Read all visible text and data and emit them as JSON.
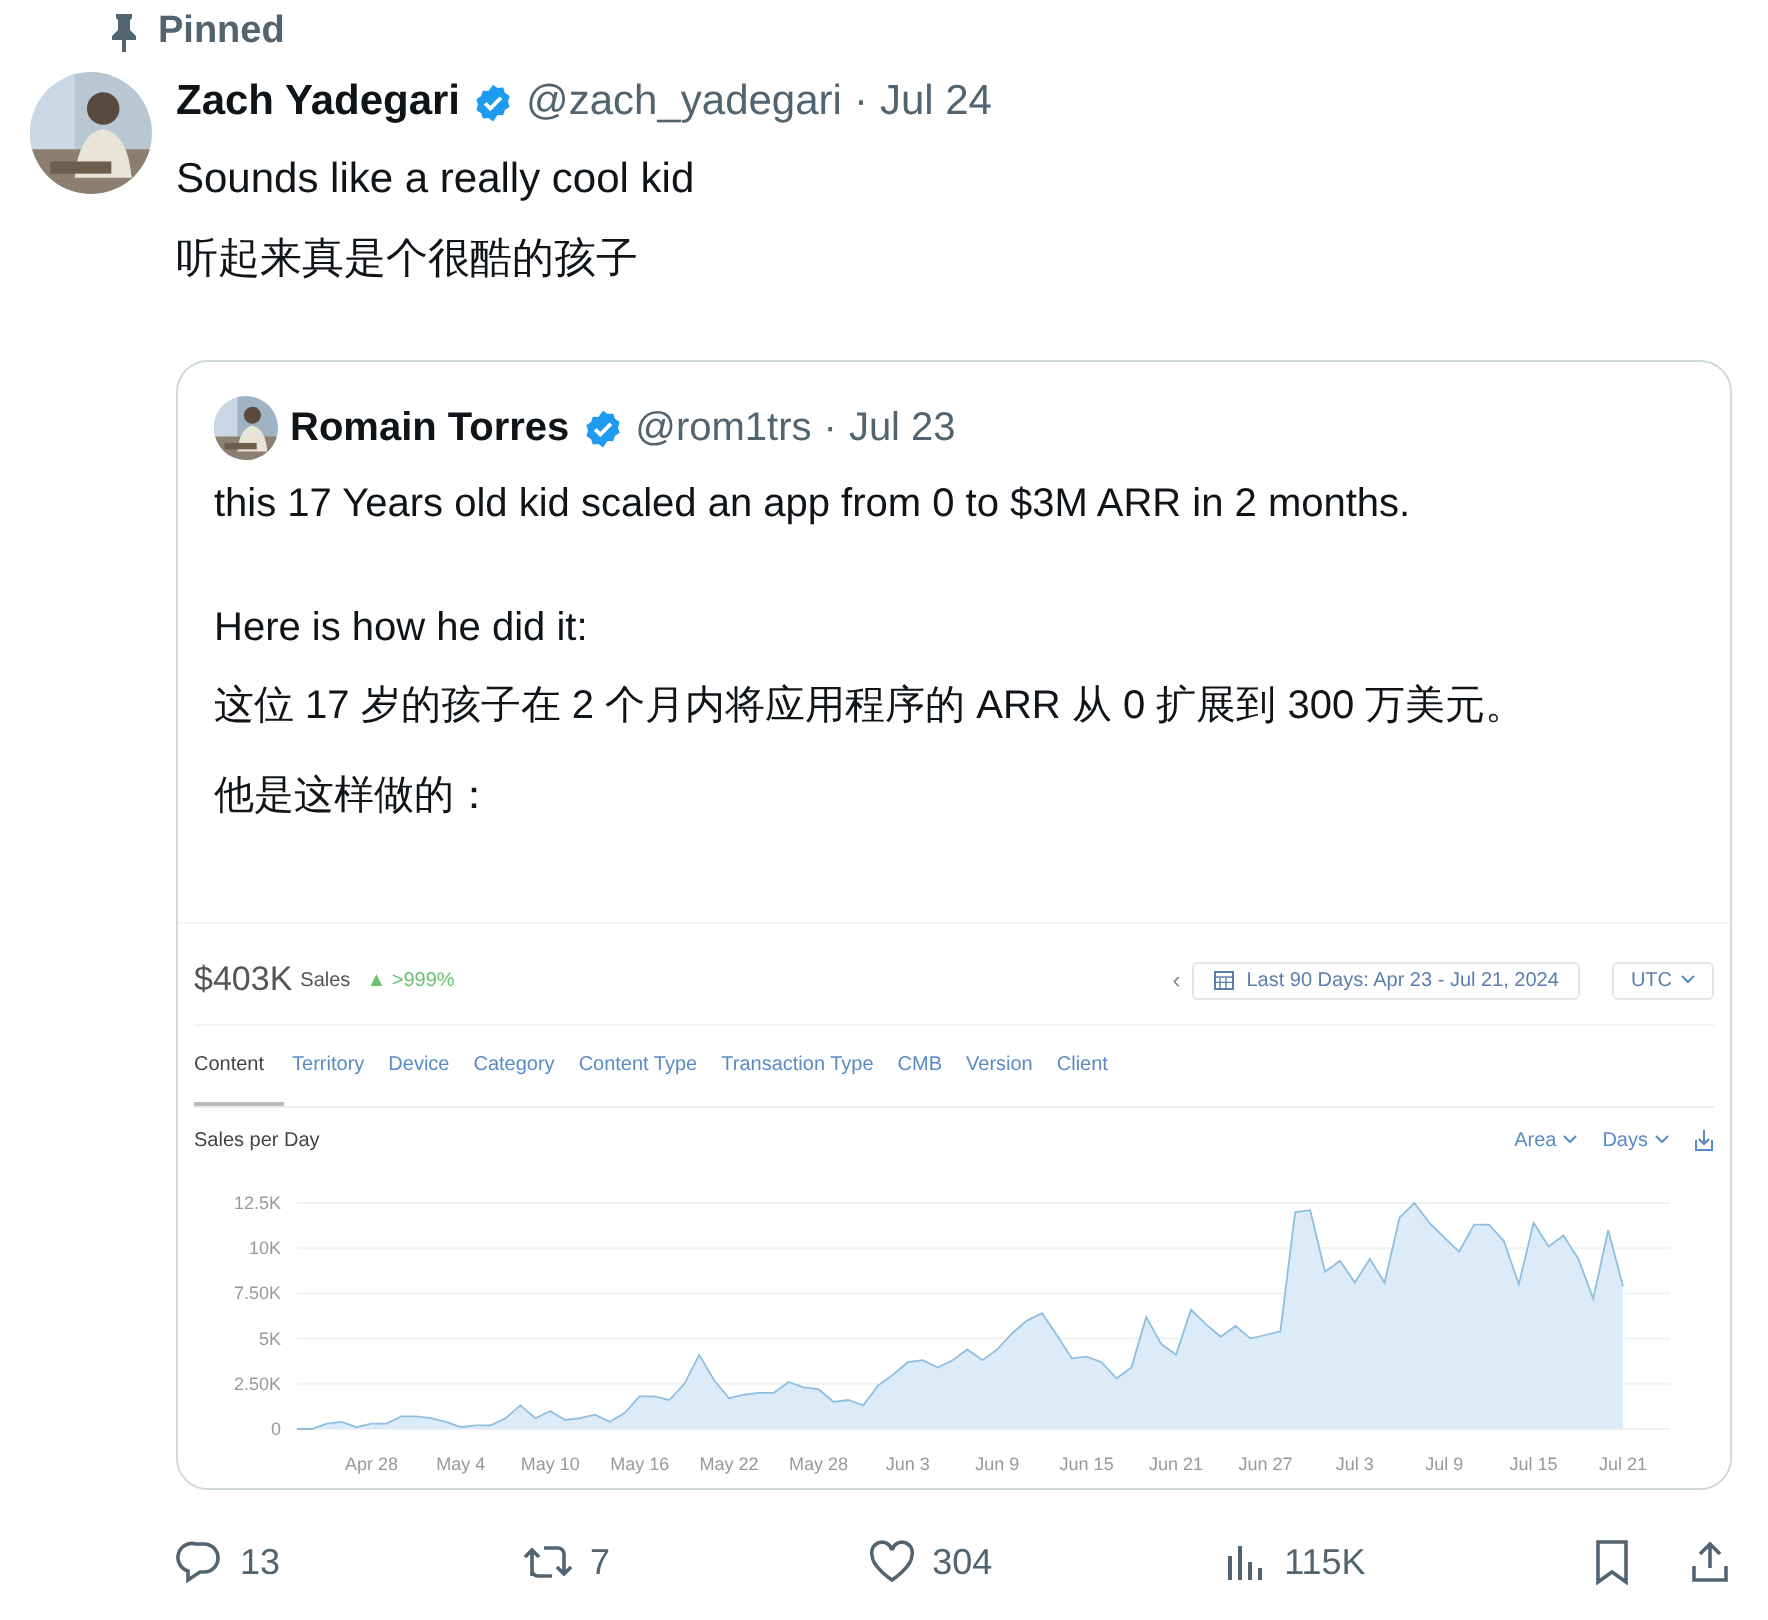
{
  "pinned": {
    "label": "Pinned"
  },
  "tweet": {
    "name": "Zach Yadegari",
    "verified": true,
    "handle": "@zach_yadegari",
    "dot": "·",
    "date": "Jul 24",
    "lines": [
      "Sounds like a really cool kid",
      "听起来真是个很酷的孩子"
    ]
  },
  "quote": {
    "name": "Romain Torres",
    "verified": true,
    "handle": "@rom1trs",
    "dot": "·",
    "date": "Jul 23",
    "paragraphs": [
      "this 17 Years old kid scaled an app from 0 to $3M ARR in 2 months.",
      "Here is how he did it:",
      "这位 17 岁的孩子在 2 个月内将应用程序的 ARR 从 0 扩展到 300 万美元。",
      "他是这样做的："
    ]
  },
  "dashboard": {
    "total": "$403K",
    "total_label": "Sales",
    "change": "▲ >999%",
    "prev": "‹",
    "date_range": "Last 90 Days: Apr 23 - Jul 21, 2024",
    "timezone": "UTC",
    "tabs": [
      {
        "label": "Content",
        "selected": true
      },
      {
        "label": "Territory",
        "selected": false
      },
      {
        "label": "Device",
        "selected": false
      },
      {
        "label": "Category",
        "selected": false
      },
      {
        "label": "Content Type",
        "selected": false
      },
      {
        "label": "Transaction Type",
        "selected": false
      },
      {
        "label": "CMB",
        "selected": false
      },
      {
        "label": "Version",
        "selected": false
      },
      {
        "label": "Client",
        "selected": false
      }
    ],
    "chart_title": "Sales per Day",
    "chart_type_menu": "Area",
    "period_menu": "Days",
    "chart_data": {
      "type": "area",
      "categories": [
        null,
        null,
        null,
        null,
        null,
        "Apr 28",
        null,
        null,
        null,
        null,
        null,
        "May 4",
        null,
        null,
        null,
        null,
        null,
        "May 10",
        null,
        null,
        null,
        null,
        null,
        "May 16",
        null,
        null,
        null,
        null,
        null,
        "May 22",
        null,
        null,
        null,
        null,
        null,
        "May 28",
        null,
        null,
        null,
        null,
        null,
        "Jun 3",
        null,
        null,
        null,
        null,
        null,
        "Jun 9",
        null,
        null,
        null,
        null,
        null,
        "Jun 15",
        null,
        null,
        null,
        null,
        null,
        "Jun 21",
        null,
        null,
        null,
        null,
        null,
        "Jun 27",
        null,
        null,
        null,
        null,
        null,
        "Jul 3",
        null,
        null,
        null,
        null,
        null,
        "Jul 9",
        null,
        null,
        null,
        null,
        null,
        "Jul 15",
        null,
        null,
        null,
        null,
        null,
        "Jul 21"
      ],
      "series": [
        {
          "color": "#8fbfe0",
          "values": [
            0,
            0,
            0.3,
            0.4,
            0.1,
            0.3,
            0.3,
            0.7,
            0.7,
            0.6,
            0.4,
            0.1,
            0.2,
            0.2,
            0.6,
            1.3,
            0.6,
            1.0,
            0.5,
            0.6,
            0.8,
            0.4,
            0.9,
            1.8,
            1.8,
            1.6,
            2.5,
            4.1,
            2.7,
            1.7,
            1.9,
            2.0,
            2.0,
            2.6,
            2.3,
            2.2,
            1.5,
            1.6,
            1.3,
            2.4,
            3.0,
            3.7,
            3.8,
            3.4,
            3.8,
            4.4,
            3.8,
            4.4,
            5.3,
            6.0,
            6.4,
            5.2,
            3.9,
            4.0,
            3.7,
            2.8,
            3.4,
            6.2,
            4.7,
            4.1,
            6.6,
            5.8,
            5.1,
            5.7,
            5.0,
            5.2,
            5.4,
            12.0,
            12.1,
            8.7,
            9.3,
            8.1,
            9.4,
            8.1,
            11.7,
            12.5,
            11.4,
            10.6,
            9.8,
            11.3,
            11.3,
            10.4,
            8.0,
            11.4,
            10.1,
            10.7,
            9.4,
            7.2,
            11.0,
            7.9
          ]
        }
      ],
      "ylim": [
        0,
        12.5
      ],
      "grid": true,
      "yticks": [
        {
          "value": 0,
          "label": "0"
        },
        {
          "value": 2.5,
          "label": "2.50K"
        },
        {
          "value": 5,
          "label": "5K"
        },
        {
          "value": 7.5,
          "label": "7.50K"
        },
        {
          "value": 10,
          "label": "10K"
        },
        {
          "value": 12.5,
          "label": "12.5K"
        }
      ]
    }
  },
  "actions": [
    {
      "kind": "reply",
      "count": "13"
    },
    {
      "kind": "repost",
      "count": "7"
    },
    {
      "kind": "like",
      "count": "304"
    },
    {
      "kind": "views",
      "count": "115K"
    },
    {
      "kind": "bookmark"
    },
    {
      "kind": "share"
    }
  ]
}
